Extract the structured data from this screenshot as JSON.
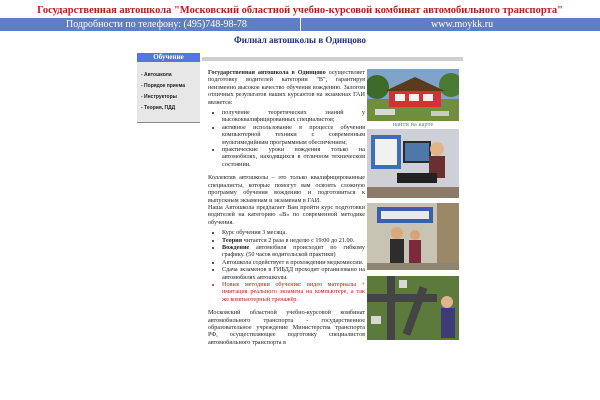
{
  "header": {
    "title": "Государственная автошкола \"Московский областной учебно-курсовой комбинат автомобильного транспорта\"",
    "phone": "Подробности по телефону: (495)748-98-78",
    "site": "www.moykk.ru"
  },
  "subtitle": "Филиал автошколы в Одинцово",
  "nav": {
    "heading": "Обучение",
    "items": [
      "- Автошкола",
      "- Порядок приема",
      "- Инструкторы",
      "- Теория, ПДД"
    ]
  },
  "content": {
    "intro_bold": "Государственная автошкола в Одинцово",
    "intro_rest": " осуществляет подготовку водителей категории \"В\", гарантируя неизменно высокое качество обучения вождению. Залогом отличных результатов наших курсантов на экзаменах ГАИ является:",
    "list1": [
      "получение теоретических знаний у высококвалифицированных специалистов;",
      "активное использование в процессе обучения компьютерной техники с современным мультимедийным программным обеспечением;",
      "практические уроки вождения только на автомобилях, находящихся в отличном техническом состоянии."
    ],
    "para2": "Коллектив автошколы – это только квалифицированные специалисты, которые помогут вам освоить сложную программу обучения вождению и подготовиться к выпускным экзаменам и экзаменам в ГАИ.",
    "para3": "Наша Автошкола предлагает Вам пройти курс подготовки водителей на категорию «В» по современной методике обучения.",
    "list2_1": "Курс обучения 3 месяца.",
    "list2_2_bold": "Теория",
    "list2_2_rest": " читается 2 раза в неделю с 19:00 до 21.00.",
    "list2_3_bold": "Вождение",
    "list2_3_rest": " автомобиля происходит по гибкому графику. (50 часов водительской практики)",
    "list2_4": "Автошкола содействует в прохождении медкомиссии.",
    "list2_5": "Сдача экзаменов в ГИБДД проходит организовано на автомобилях автошколы.",
    "list2_6": "Новые методики обучения: видео материалы + имитация реального экзамена на компьютере, а так же компьютерный тренажёр.",
    "para4": "Московский областной учебно-курсовой комбинат автомобильного транспорта - государственное образовательное учреждение Министерства транспорта РФ, осуществляющее подготовку специалистов автомобильного транспорта в"
  },
  "photos": {
    "caption1": "найти на карте"
  },
  "colors": {
    "title_red": "#b81c1c",
    "blue_bar": "#5e7fc6",
    "nav_head": "#5577dd",
    "link_blue": "#5f7ab5"
  }
}
